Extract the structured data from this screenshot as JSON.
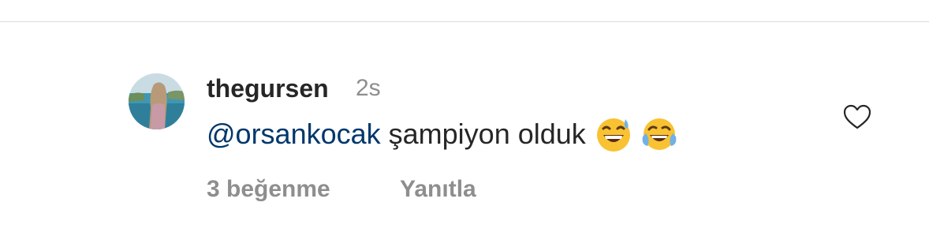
{
  "comment": {
    "username": "thegursen",
    "timestamp": "2s",
    "mention": "@orsankocak",
    "text": "şampiyon olduk",
    "emojis": [
      "grinning-face-with-sweat-emoji",
      "face-with-tears-of-joy-emoji"
    ],
    "likes_label": "3 beğenme",
    "reply_label": "Yanıtla"
  },
  "colors": {
    "text": "#262626",
    "secondary": "#8e8e8e",
    "mention": "#00376b",
    "divider": "#dbdbdb"
  },
  "icons": {
    "like": "heart-outline-icon"
  }
}
